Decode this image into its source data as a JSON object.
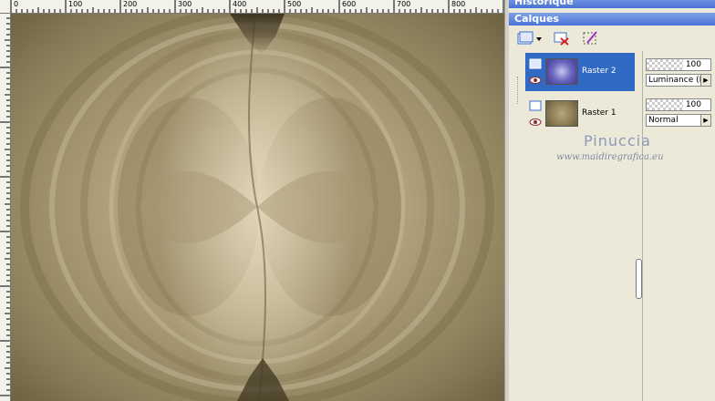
{
  "ruler": {
    "top_ticks": [
      "0",
      "100",
      "200",
      "300",
      "400",
      "500",
      "600",
      "700",
      "800"
    ]
  },
  "panels": {
    "history_title": "Historique",
    "layers_title": "Calques"
  },
  "layers": [
    {
      "name": "Raster 2",
      "selected": true,
      "opacity": "100",
      "blend": "Luminance (H)"
    },
    {
      "name": "Raster 1",
      "selected": false,
      "opacity": "100",
      "blend": "Normal"
    }
  ],
  "watermark": {
    "name": "Pinuccia",
    "site": "www.maidiregrafica.eu"
  },
  "colors": {
    "selection": "#316ac5",
    "titlebar": "#4a72d4",
    "canvas_dark": "#5e5436",
    "canvas_light": "#cfc3a0"
  }
}
